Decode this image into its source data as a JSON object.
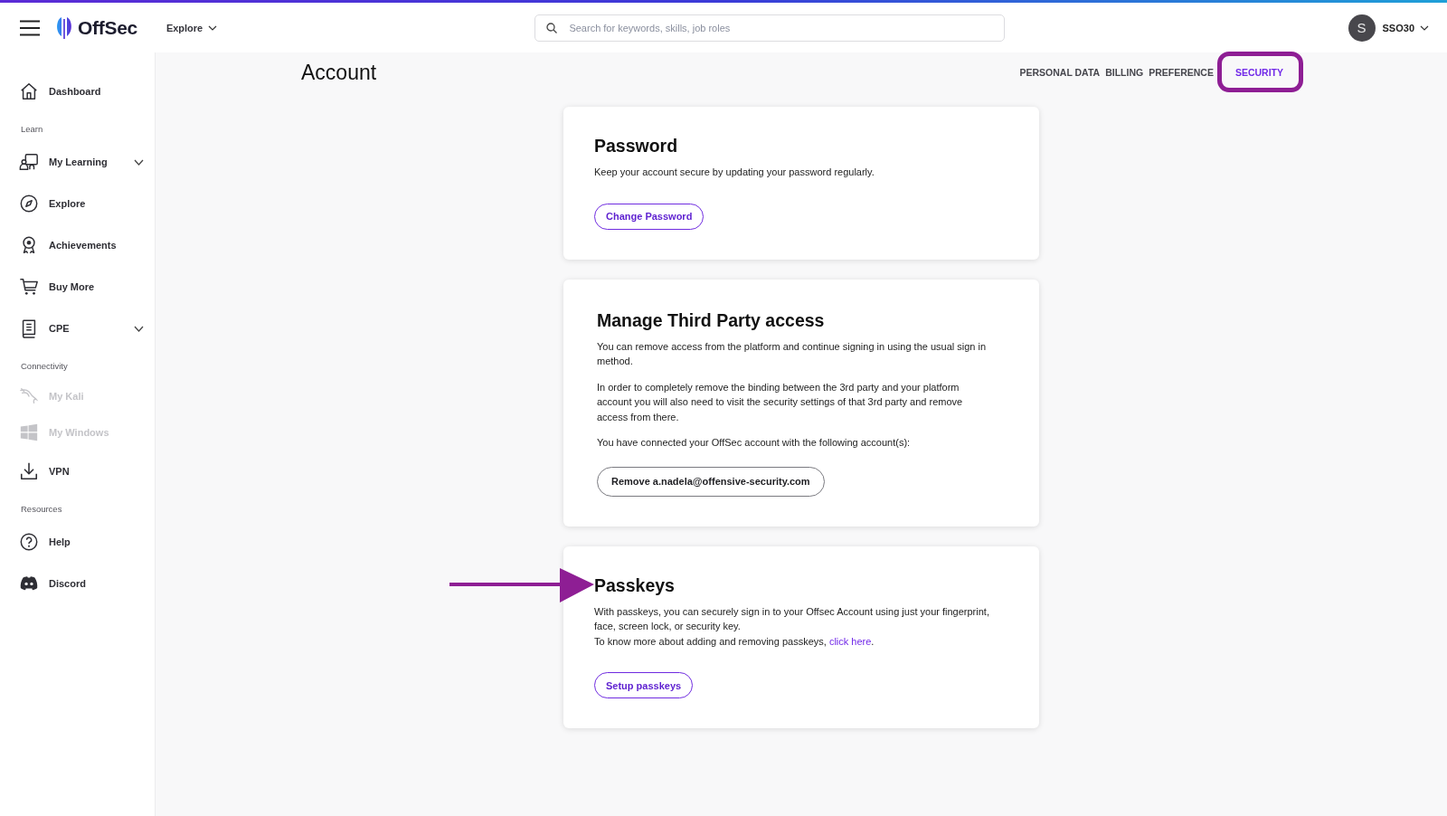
{
  "header": {
    "logo": "OffSec",
    "explore_menu": "Explore",
    "search": {
      "placeholder": "Search for keywords, skills, job roles"
    },
    "user": {
      "avatar_initial": "S",
      "name": "SSO30"
    }
  },
  "sidebar": {
    "sections": [
      {
        "items": [
          {
            "label": "Dashboard",
            "disabled": false
          }
        ]
      },
      {
        "heading": "Learn",
        "items": [
          {
            "label": "My Learning",
            "disabled": false,
            "expanded": false
          },
          {
            "label": "Explore",
            "disabled": false
          },
          {
            "label": "Achievements",
            "disabled": false
          },
          {
            "label": "Buy More",
            "disabled": false
          },
          {
            "label": "CPE",
            "disabled": false,
            "expanded": false
          }
        ]
      },
      {
        "heading": "Connectivity",
        "items": [
          {
            "label": "My Kali",
            "disabled": true
          },
          {
            "label": "My Windows",
            "disabled": true
          },
          {
            "label": "VPN",
            "disabled": false
          }
        ]
      },
      {
        "heading": "Resources",
        "items": [
          {
            "label": "Help",
            "disabled": false
          },
          {
            "label": "Discord",
            "disabled": false
          }
        ]
      }
    ]
  },
  "page": {
    "title": "Account",
    "tabs": [
      {
        "label": "PERSONAL DATA",
        "selected": false,
        "highlighted": false
      },
      {
        "label": "BILLING",
        "selected": false,
        "highlighted": false
      },
      {
        "label": "PREFERENCE",
        "selected": false,
        "highlighted": false
      },
      {
        "label": "SECURITY",
        "selected": true,
        "highlighted": true
      }
    ]
  },
  "cards": [
    {
      "title": "Password",
      "pointed": false,
      "paragraphs": [
        {
          "text": "Keep your account secure by updating your password regularly."
        }
      ],
      "button": {
        "label": "Change Password",
        "kind": "primary"
      }
    },
    {
      "title": "Manage Third Party access",
      "pointed": false,
      "paragraphs": [
        {
          "text": "You can remove access from the platform and continue signing in using the usual sign in method."
        },
        {
          "text": "In order to completely remove the binding between the 3rd party and your platform account you will also need to visit the security settings of that 3rd party and remove access from there."
        },
        {
          "text": "You have connected your OffSec account with the following account(s):"
        }
      ],
      "button": {
        "label": "Remove a.nadela@offensive-security.com",
        "kind": "secondary"
      }
    },
    {
      "title": "Passkeys",
      "pointed": true,
      "lines": [
        {
          "text": "With passkeys, you can securely sign in to your Offsec Account using just your fingerprint, face, screen lock, or security key."
        },
        {
          "text": "To know more about adding and removing passkeys, ",
          "link": "click here",
          "text_after": "."
        }
      ],
      "button": {
        "label": "Setup passkeys",
        "kind": "primary"
      }
    }
  ]
}
